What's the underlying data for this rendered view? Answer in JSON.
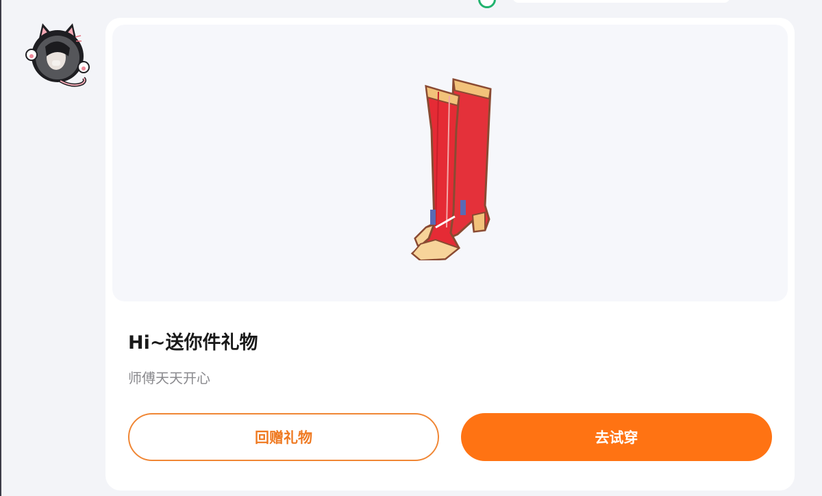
{
  "colors": {
    "accent": "#ff7313",
    "accent_text": "#ef7a22",
    "card_bg": "#ffffff",
    "preview_bg": "#f6f7fb",
    "status_green": "#21b36e"
  },
  "sender": {
    "avatar_icon": "cat-ear-avatar-icon"
  },
  "gift": {
    "item_icon": "red-knee-high-boots-icon",
    "title": "Hi~送你件礼物",
    "message": "师傅天天开心"
  },
  "actions": {
    "return_gift_label": "回赠礼物",
    "try_on_label": "去试穿"
  }
}
